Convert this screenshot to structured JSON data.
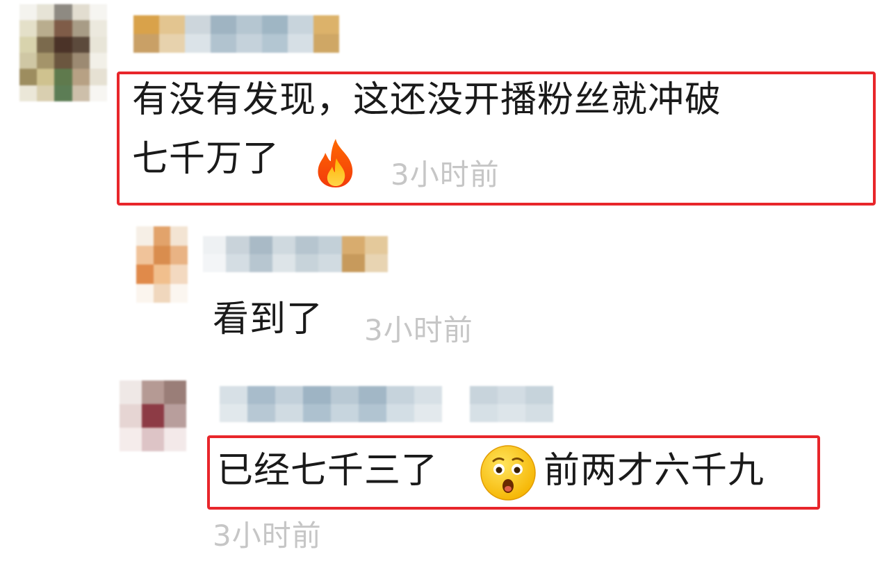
{
  "comments": [
    {
      "text_line1": "有没有发现，这还没开播粉丝就冲破",
      "text_line2": "七千万了",
      "emoji": "fire-icon",
      "time": "3小时前"
    },
    {
      "text": "看到了",
      "time": "3小时前"
    },
    {
      "text_part1": "已经七千三了",
      "emoji": "surprised-face-icon",
      "text_part2": "前两才六千九",
      "time": "3小时前"
    }
  ],
  "colors": {
    "highlight": "#e8262b",
    "timestamp": "#c6c6c6",
    "text": "#1a1a1a"
  }
}
